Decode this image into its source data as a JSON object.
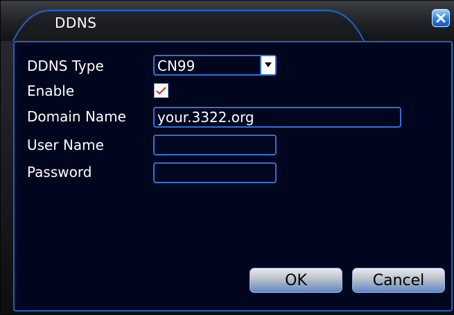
{
  "window": {
    "title": "DDNS",
    "close_icon": "close-icon"
  },
  "form": {
    "ddns_type": {
      "label": "DDNS Type",
      "value": "CN99"
    },
    "enable": {
      "label": "Enable",
      "checked": true
    },
    "domain_name": {
      "label": "Domain Name",
      "value": "your.3322.org"
    },
    "user_name": {
      "label": "User Name",
      "value": ""
    },
    "password": {
      "label": "Password",
      "value": ""
    }
  },
  "buttons": {
    "ok_label": "OK",
    "cancel_label": "Cancel"
  },
  "colors": {
    "accent": "#2b74d9",
    "panel_bg": "#00061e",
    "checkmark": "#e02020"
  }
}
